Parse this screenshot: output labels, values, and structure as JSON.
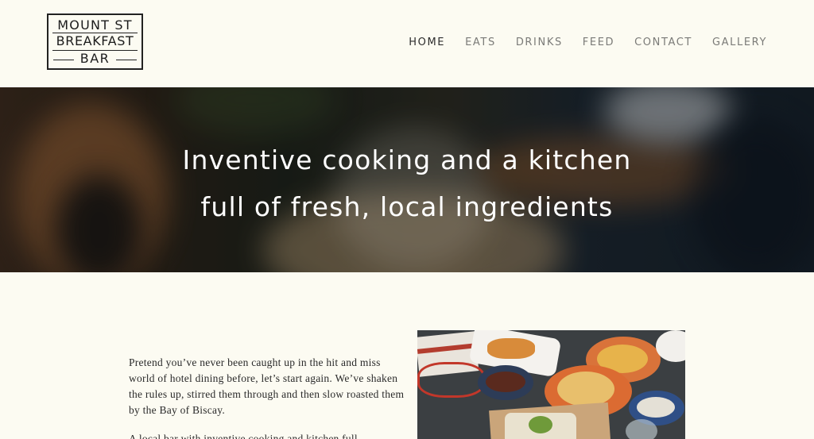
{
  "logo": {
    "line1": "MOUNT ST",
    "line2": "BREAKFAST",
    "line3": "BAR"
  },
  "nav": {
    "items": [
      "HOME",
      "EATS",
      "DRINKS",
      "FEED",
      "CONTACT",
      "GALLERY"
    ],
    "active": "HOME"
  },
  "hero": {
    "line1": "Inventive cooking and a kitchen",
    "line2": "full of fresh, local ingredients"
  },
  "content": {
    "paragraph1": "Pretend you’ve never been caught up in the hit and miss world of hotel dining before, let’s start again. We’ve shaken the rules up, stirred them through and then slow roasted them by the Bay of Biscay.",
    "paragraph2": "A local bar with inventive cooking and kitchen full"
  },
  "colors": {
    "background": "#fcfbf2",
    "nav_text": "#7b7b78",
    "nav_active": "#2c2c2c",
    "body_text": "#2a2a2a"
  }
}
